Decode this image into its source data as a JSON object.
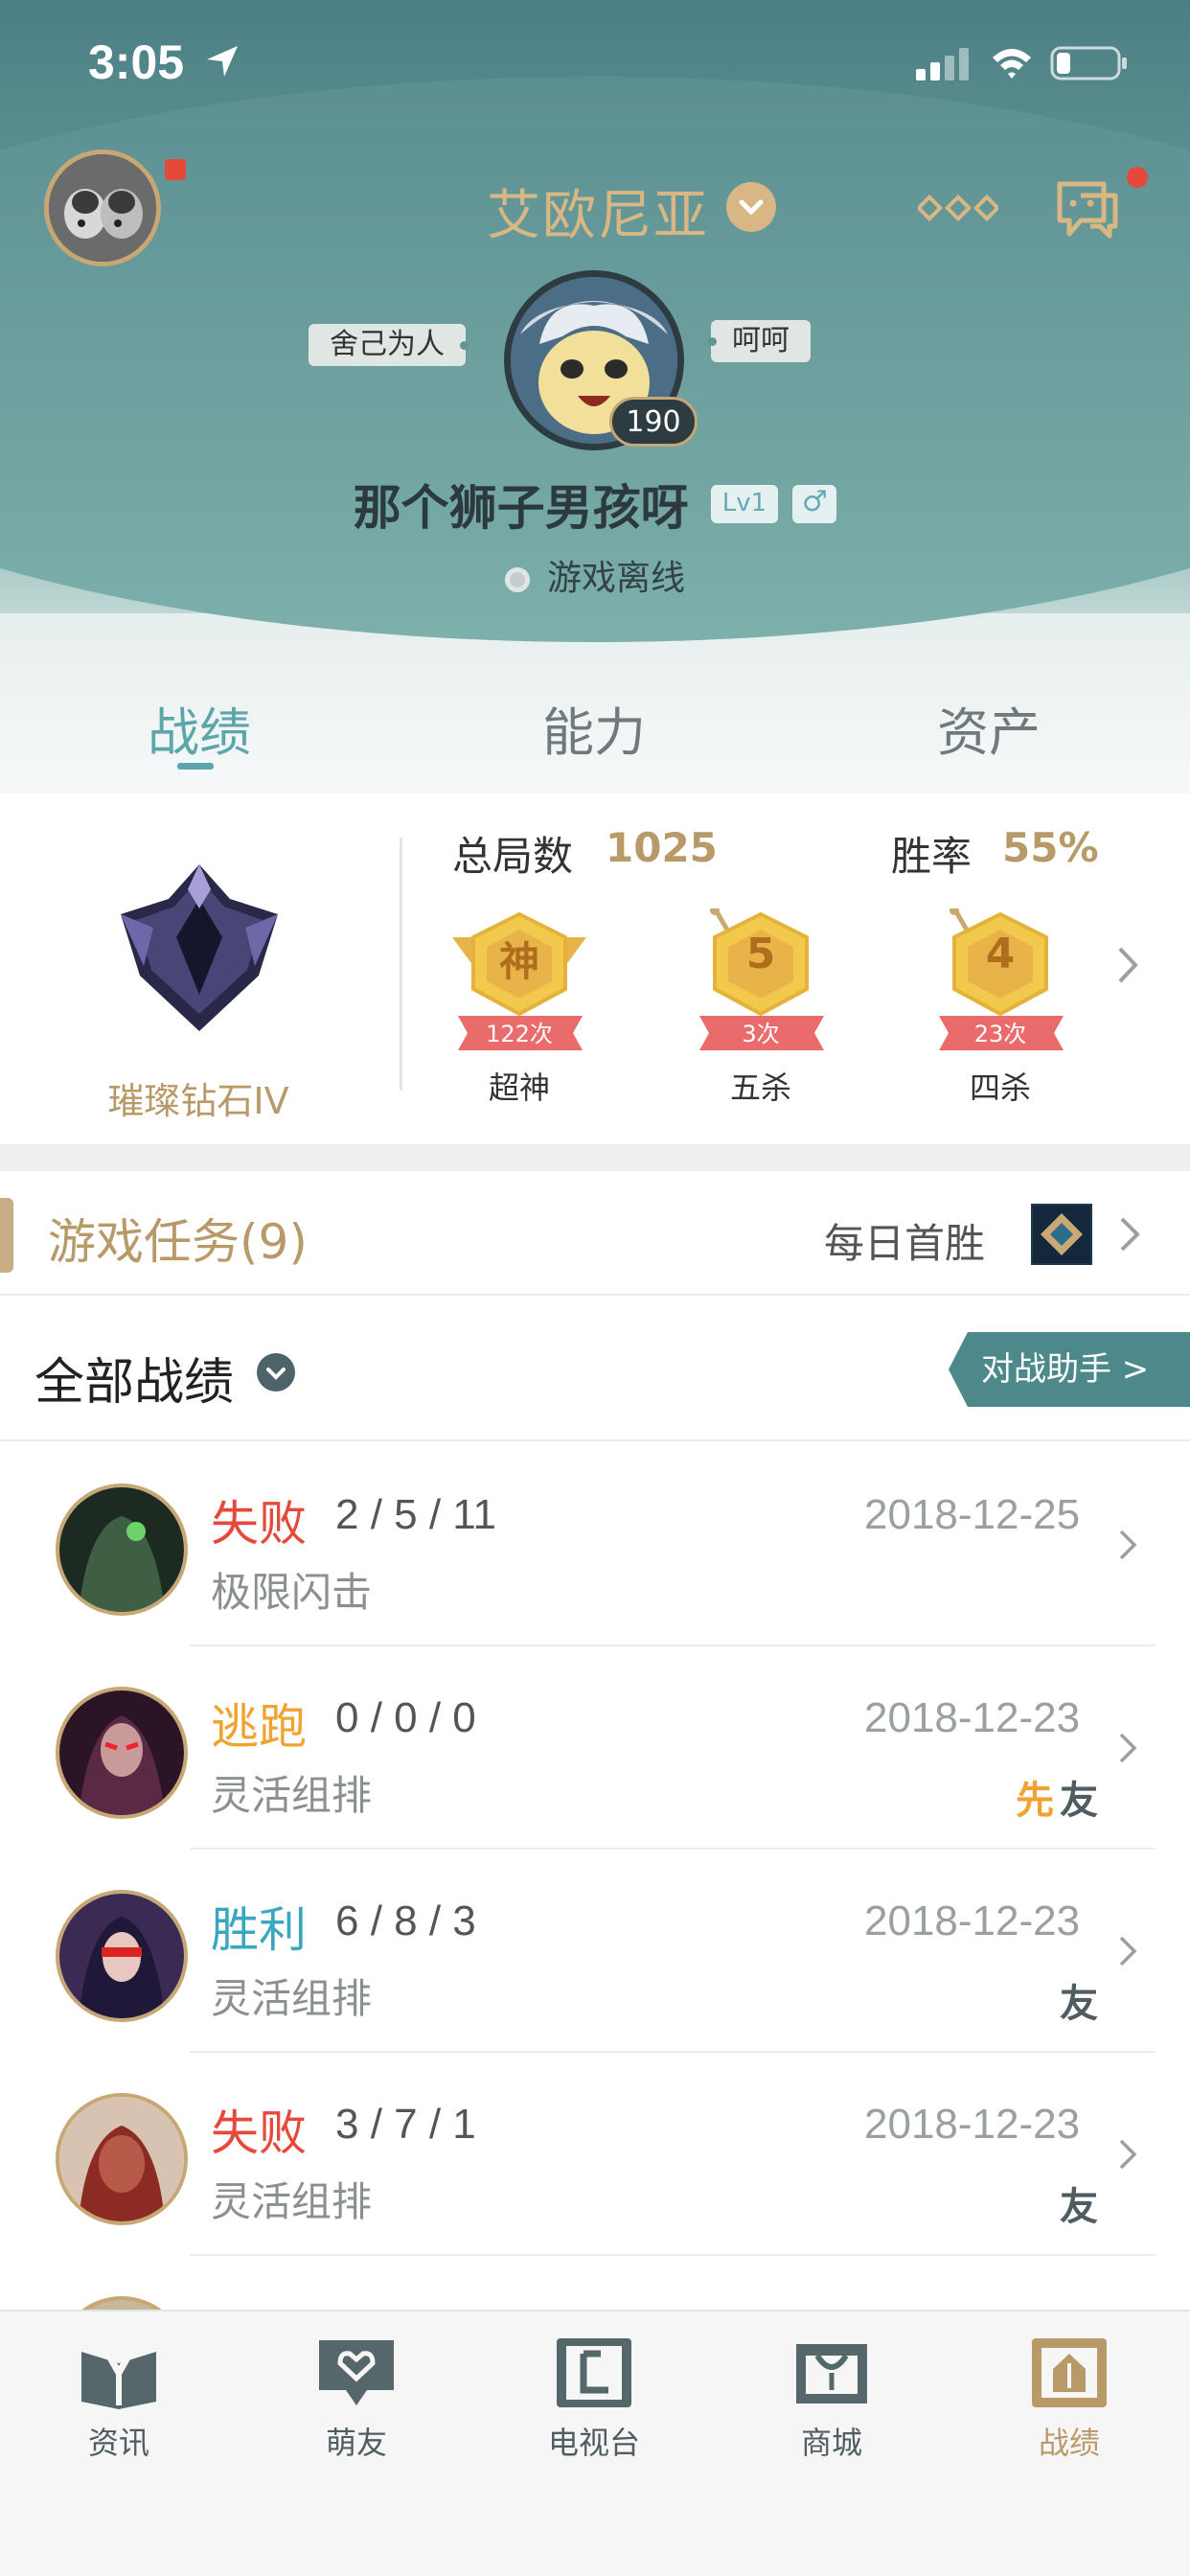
{
  "status_bar": {
    "time": "3:05"
  },
  "header": {
    "server_name": "艾欧尼亚",
    "tag_left": "舍己为人",
    "tag_right": "呵呵",
    "avatar_level": "190",
    "nickname": "那个狮子男孩呀",
    "player_level": "Lv1",
    "gender_symbol": "♂",
    "online_status": "游戏离线"
  },
  "tabs": [
    {
      "label": "战绩",
      "active": true
    },
    {
      "label": "能力",
      "active": false
    },
    {
      "label": "资产",
      "active": false
    }
  ],
  "stats": {
    "rank_name": "璀璨钻石IV",
    "total_games_label": "总局数",
    "total_games_value": "1025",
    "win_rate_label": "胜率",
    "win_rate_value": "55%",
    "medals": [
      {
        "glyph": "神",
        "count": "122次",
        "label": "超神"
      },
      {
        "glyph": "5",
        "count": "3次",
        "label": "五杀"
      },
      {
        "glyph": "4",
        "count": "23次",
        "label": "四杀"
      }
    ]
  },
  "quests": {
    "title": "游戏任务(9)",
    "daily_label": "每日首胜"
  },
  "filter": {
    "title": "全部战绩",
    "assist_button": "对战助手 >"
  },
  "matches": [
    {
      "result": "失败",
      "result_color": "#e5493a",
      "kda": "2 / 5 / 11",
      "mode": "极限闪击",
      "date": "2018-12-25",
      "badges": []
    },
    {
      "result": "逃跑",
      "result_color": "#f0a330",
      "kda": "0 / 0 / 0",
      "mode": "灵活组排",
      "date": "2018-12-23",
      "badges": [
        "先",
        "友"
      ]
    },
    {
      "result": "胜利",
      "result_color": "#3aa7c0",
      "kda": "6 / 8 / 3",
      "mode": "灵活组排",
      "date": "2018-12-23",
      "badges": [
        "友"
      ]
    },
    {
      "result": "失败",
      "result_color": "#e5493a",
      "kda": "3 / 7 / 1",
      "mode": "灵活组排",
      "date": "2018-12-23",
      "badges": [
        "友"
      ]
    }
  ],
  "bottom_nav": [
    {
      "label": "资讯",
      "icon": "news-icon",
      "active": false
    },
    {
      "label": "萌友",
      "icon": "friends-icon",
      "active": false
    },
    {
      "label": "电视台",
      "icon": "tv-icon",
      "active": false
    },
    {
      "label": "商城",
      "icon": "store-icon",
      "active": false
    },
    {
      "label": "战绩",
      "icon": "record-icon",
      "active": true
    }
  ],
  "colors": {
    "accent_teal": "#5aa6aa",
    "gold": "#b89968",
    "loss": "#e5493a",
    "win": "#3aa7c0",
    "escape": "#f0a330"
  }
}
